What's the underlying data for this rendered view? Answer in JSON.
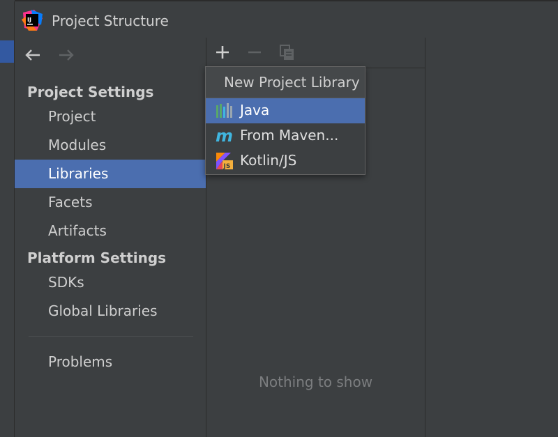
{
  "window": {
    "title": "Project Structure"
  },
  "navigation": {
    "back_icon": "arrow-left-icon",
    "forward_icon": "arrow-right-icon"
  },
  "sidebar": {
    "project_settings_header": "Project Settings",
    "project_settings_items": [
      {
        "label": "Project",
        "selected": false
      },
      {
        "label": "Modules",
        "selected": false
      },
      {
        "label": "Libraries",
        "selected": true
      },
      {
        "label": "Facets",
        "selected": false
      },
      {
        "label": "Artifacts",
        "selected": false
      }
    ],
    "platform_settings_header": "Platform Settings",
    "platform_settings_items": [
      {
        "label": "SDKs"
      },
      {
        "label": "Global Libraries"
      }
    ],
    "problems_label": "Problems"
  },
  "toolbar": {
    "add_icon": "plus-icon",
    "remove_icon": "minus-icon",
    "copy_icon": "copy-icon"
  },
  "main": {
    "empty_text": "Nothing to show"
  },
  "popup": {
    "header": "New Project Library",
    "items": [
      {
        "label": "Java",
        "icon": "java-library-icon",
        "selected": true
      },
      {
        "label": "From Maven...",
        "icon": "maven-icon",
        "selected": false
      },
      {
        "label": "Kotlin/JS",
        "icon": "kotlin-js-icon",
        "selected": false
      }
    ]
  },
  "colors": {
    "selection": "#4b6eaf",
    "panel": "#3c3f41",
    "text": "#cfcfcf"
  }
}
